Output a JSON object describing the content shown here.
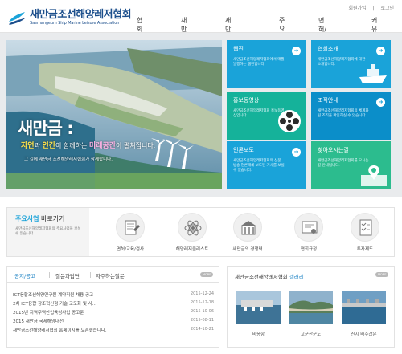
{
  "header": {
    "util_links": [
      "회원가입",
      "로그인"
    ],
    "logo_ko": "새만금조선해양레저협회",
    "logo_en": "Saemangeum Ship Marine Leisure Association",
    "nav": [
      "협회소개",
      "새만금소개",
      "새만금산업단지",
      "주요사업",
      "면허/교육/검사",
      "커뮤니티"
    ]
  },
  "hero": {
    "title": "새만금 :",
    "sub_a": "자연",
    "sub_b": "과 ",
    "sub_c": "인간",
    "sub_d": "이 함께하는 ",
    "sub_e": "미래공간",
    "sub_f": "이 펼쳐집니다.",
    "small": "그 길에 새만금 조선해양레저협회가 함께합니다."
  },
  "tiles": [
    {
      "title": "웹진",
      "desc": "새만금조선해양레저협회에서 매월 발행하는 웹진입니다."
    },
    {
      "title": "협회소개",
      "desc": "새만금조선해양레저협회에 대한 소개입니다."
    },
    {
      "title": "홍보동영상",
      "desc": "새만금조선해양레저협회 홍보동영상입니다."
    },
    {
      "title": "조직안내",
      "desc": "새만금조선해양레저협회의 체계화된 조직을 확인하실 수 있습니다."
    },
    {
      "title": "언론보도",
      "desc": "새만금조선해양레저협회의 신문 방송 언론매체 보도된 기사를 보실 수 있습니다."
    },
    {
      "title": "찾아오시는길",
      "desc": "새만금조선해양레저협회를 오시는 길 안내입니다."
    }
  ],
  "business": {
    "heading_a": "주요사업",
    "heading_b": " 바로가기",
    "desc": "새만금조선해양레저협회의 주요사업을 보실 수 있습니다.",
    "items": [
      "면허/교육/검사",
      "해양레저클러스트",
      "새만금의 경쟁력",
      "협회규정",
      "투자제도"
    ]
  },
  "notice": {
    "tabs": [
      "공지/공고",
      "질문과답변",
      "자주하는질문"
    ],
    "more": "MORE",
    "rows": [
      {
        "title": "ICT융합조선해양연구원 계약직원 채용 공고",
        "date": "2015-12-24"
      },
      {
        "title": "2차 ICT융합 창조혁신형 기술 고도화 및 사...",
        "date": "2015-12-18"
      },
      {
        "title": "2015년 지역주력산업육성사업 공고문",
        "date": "2015-10-06"
      },
      {
        "title": "2015 새만금 국제해양대전",
        "date": "2015-08-11"
      },
      {
        "title": "새만금조선해양레저협회 홈페이지를 오픈했습니다.",
        "date": "2014-10-21"
      }
    ]
  },
  "gallery": {
    "heading_a": "새만금조선해양레저협회 ",
    "heading_b": "갤러리",
    "more": "MORE",
    "items": [
      "비응항",
      "고군산군도",
      "신시 배수갑문"
    ]
  }
}
